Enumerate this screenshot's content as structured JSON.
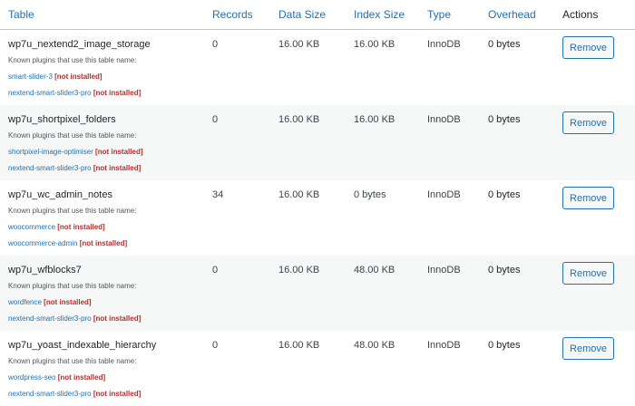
{
  "headers": {
    "table": "Table",
    "records": "Records",
    "data_size": "Data Size",
    "index_size": "Index Size",
    "type": "Type",
    "overhead": "Overhead",
    "actions": "Actions"
  },
  "known_label": "Known plugins that use this table name:",
  "remove_label": "Remove",
  "rows": [
    {
      "name": "wp7u_nextend2_image_storage",
      "records": "0",
      "data_size": "16.00 KB",
      "index_size": "16.00 KB",
      "type": "InnoDB",
      "overhead": "0 bytes",
      "plugins": [
        {
          "name": "smart-slider-3",
          "status": "[not installed]"
        },
        {
          "name": "nextend-smart-slider3-pro",
          "status": "[not installed]"
        }
      ]
    },
    {
      "name": "wp7u_shortpixel_folders",
      "records": "0",
      "data_size": "16.00 KB",
      "index_size": "16.00 KB",
      "type": "InnoDB",
      "overhead": "0 bytes",
      "plugins": [
        {
          "name": "shortpixel-image-optimiser",
          "status": "[not installed]"
        },
        {
          "name": "nextend-smart-slider3-pro",
          "status": "[not installed]"
        }
      ]
    },
    {
      "name": "wp7u_wc_admin_notes",
      "records": "34",
      "data_size": "16.00 KB",
      "index_size": "0 bytes",
      "type": "InnoDB",
      "overhead": "0 bytes",
      "plugins": [
        {
          "name": "woocommerce",
          "status": "[not installed]"
        },
        {
          "name": "woocommerce-admin",
          "status": "[not installed]"
        }
      ]
    },
    {
      "name": "wp7u_wfblocks7",
      "records": "0",
      "data_size": "16.00 KB",
      "index_size": "48.00 KB",
      "type": "InnoDB",
      "overhead": "0 bytes",
      "plugins": [
        {
          "name": "wordfence",
          "status": "[not installed]"
        },
        {
          "name": "nextend-smart-slider3-pro",
          "status": "[not installed]"
        }
      ]
    },
    {
      "name": "wp7u_yoast_indexable_hierarchy",
      "records": "0",
      "data_size": "16.00 KB",
      "index_size": "48.00 KB",
      "type": "InnoDB",
      "overhead": "0 bytes",
      "plugins": [
        {
          "name": "wordpress-seo",
          "status": "[not installed]"
        },
        {
          "name": "nextend-smart-slider3-pro",
          "status": "[not installed]"
        }
      ]
    }
  ]
}
